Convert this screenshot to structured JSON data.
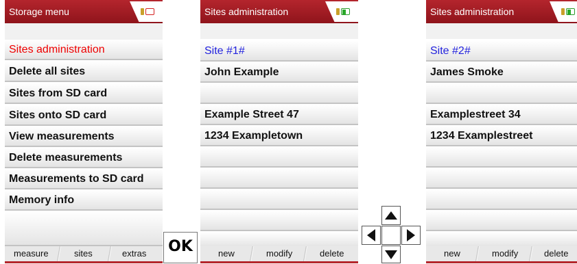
{
  "screens": [
    {
      "title": "Storage menu",
      "rows": [
        "",
        "Sites administration",
        "Delete all sites",
        "Sites from SD card",
        "Sites onto SD card",
        "View measurements",
        "Delete measurements",
        "Measurements to SD card",
        "Memory info",
        ""
      ],
      "footer": [
        "measure",
        "sites",
        "extras"
      ]
    },
    {
      "title": "Sites administration",
      "rows": [
        "Site #1#",
        "John Example",
        "",
        "Example Street 47",
        "1234 Exampletown",
        "",
        "",
        "",
        "",
        ""
      ],
      "footer": [
        "new",
        "modify",
        "delete"
      ]
    },
    {
      "title": "Sites administration",
      "rows": [
        "Site #2#",
        "James Smoke",
        "",
        "Examplestreet 34",
        "1234 Examplestreet",
        "",
        "",
        "",
        "",
        ""
      ],
      "footer": [
        "new",
        "modify",
        "delete"
      ]
    }
  ],
  "ok_key": "OK",
  "icons": {
    "battery": "battery-icon",
    "arrow_up": "arrow-up-icon",
    "arrow_left": "arrow-left-icon",
    "arrow_right": "arrow-right-icon",
    "arrow_down": "arrow-down-icon"
  },
  "colors": {
    "titlebar": "#a31d24",
    "selected": "#ee0000",
    "site_label": "#2222dd"
  }
}
